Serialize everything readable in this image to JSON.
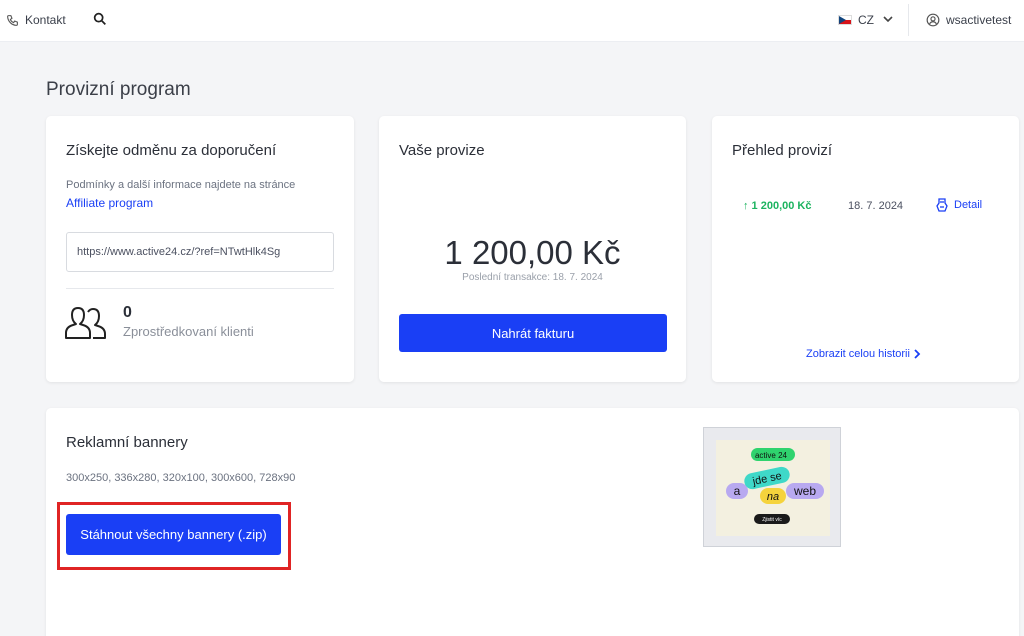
{
  "topbar": {
    "contact_label": "Kontakt",
    "lang_label": "CZ",
    "user_label": "wsactivetest",
    "icons": [
      "phone-icon",
      "search-icon",
      "flag-cz-icon",
      "chevron-down-icon",
      "user-circle-icon"
    ]
  },
  "page": {
    "title": "Provizní program"
  },
  "referral": {
    "title": "Získejte odměnu za doporučení",
    "info": "Podmínky a další informace najdete na stránce",
    "link": "Affiliate program",
    "ref_url": "https://www.active24.cz/?ref=NTwtHlk4Sg",
    "count": "0",
    "count_label": "Zprostředkovaní klienti"
  },
  "commission": {
    "title": "Vaše provize",
    "amount": "1 200,00 Kč",
    "last_transaction": "Poslední transakce: 18. 7. 2024",
    "button": "Nahrát fakturu"
  },
  "overview": {
    "title": "Přehled provizí",
    "rows": [
      {
        "amount": "↑ 1 200,00 Kč",
        "date": "18. 7. 2024",
        "detail": "Detail"
      }
    ],
    "history_link": "Zobrazit celou historii"
  },
  "banners": {
    "title": "Reklamní bannery",
    "sizes": "300x250, 336x280, 320x100, 300x600, 728x90",
    "download_button": "Stáhnout všechny bannery (.zip)",
    "preview": {
      "badge": "active 24",
      "words": [
        "a",
        "jde se",
        "na",
        "web"
      ],
      "cta": "Zjistit víc"
    }
  },
  "colors": {
    "primary": "#1a3ff5",
    "positive": "#1cb35f",
    "highlight": "#e02424",
    "background": "#f4f5f7"
  }
}
